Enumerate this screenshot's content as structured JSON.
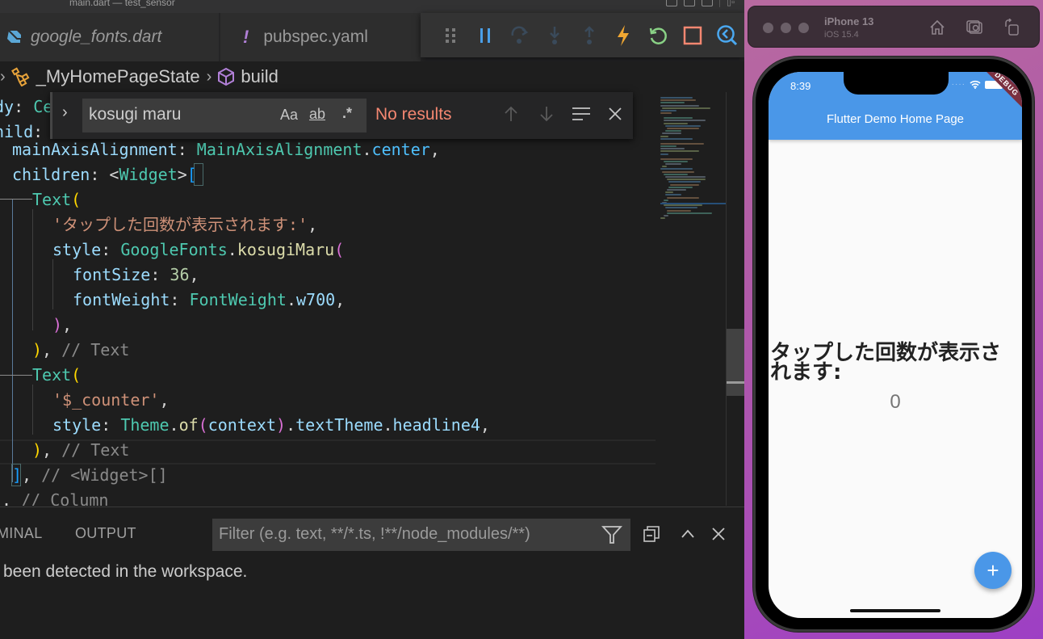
{
  "window": {
    "title": "main.dart — test_sensor"
  },
  "tabs": [
    {
      "label": "google_fonts.dart",
      "icon": "dart-file-icon",
      "italic": true
    },
    {
      "label": "pubspec.yaml",
      "icon": "yaml-warning-icon"
    }
  ],
  "debug_toolbar": {
    "buttons": [
      {
        "name": "drag-handle",
        "icon": "grip-icon"
      },
      {
        "name": "pause",
        "icon": "pause-icon",
        "color": "#4a9fe8"
      },
      {
        "name": "step-over",
        "icon": "step-over-icon",
        "disabled": true
      },
      {
        "name": "step-into",
        "icon": "step-into-icon",
        "disabled": true
      },
      {
        "name": "step-out",
        "icon": "step-out-icon",
        "disabled": true
      },
      {
        "name": "hot-reload",
        "icon": "lightning-icon",
        "color": "#f0a732"
      },
      {
        "name": "hot-restart",
        "icon": "restart-icon",
        "color": "#89d185"
      },
      {
        "name": "stop",
        "icon": "stop-icon",
        "color": "#f48771"
      },
      {
        "name": "flutter-inspector",
        "icon": "inspector-icon",
        "color": "#4aa8f0"
      }
    ]
  },
  "breadcrumb": {
    "items": [
      {
        "label": "_MyHomePageState",
        "icon": "class-icon"
      },
      {
        "label": "build",
        "icon": "method-icon"
      }
    ]
  },
  "find": {
    "query": "kosugi maru",
    "match_case_label": "Aa",
    "whole_word_label": "ab",
    "regex_label": ".*",
    "status": "No results"
  },
  "code": {
    "lines": [
      "dy: Ce",
      "hild:",
      "  mainAxisAlignment: MainAxisAlignment.center,",
      "  children: <Widget>[",
      "    Text(",
      "      'タップした回数が表示されます:',",
      "      style: GoogleFonts.kosugiMaru(",
      "        fontSize: 36,",
      "        fontWeight: FontWeight.w700,",
      "      ),",
      "    ), // Text",
      "    Text(",
      "      '$_counter',",
      "      style: Theme.of(context).textTheme.headline4,",
      "    ), // Text",
      "  ], // <Widget>[]",
      ", // Column"
    ],
    "tokens": {
      "l0a": "dy",
      "l0b": ": ",
      "l0c": "Ce",
      "l1a": "hild",
      "l1b": ":",
      "l2a": "mainAxisAlignment",
      "l2b": ": ",
      "l2c": "MainAxisAlignment",
      "l2d": ".",
      "l2e": "center",
      "l2f": ",",
      "l3a": "children",
      "l3b": ": <",
      "l3c": "Widget",
      "l3d": ">",
      "l3e": "[",
      "l4a": "Text",
      "l4b": "(",
      "l5a": "'タップした回数が表示されます:'",
      "l5b": ",",
      "l6a": "style",
      "l6b": ": ",
      "l6c": "GoogleFonts",
      "l6d": ".",
      "l6e": "kosugiMaru",
      "l6f": "(",
      "l7a": "fontSize",
      "l7b": ": ",
      "l7c": "36",
      "l7d": ",",
      "l8a": "fontWeight",
      "l8b": ": ",
      "l8c": "FontWeight",
      "l8d": ".",
      "l8e": "w700",
      "l8f": ",",
      "l9a": ")",
      "l9b": ",",
      "l10a": ")",
      "l10b": ", ",
      "l10c": "// Text",
      "l11a": "Text",
      "l11b": "(",
      "l12a": "'$_counter'",
      "l12b": ",",
      "l13a": "style",
      "l13b": ": ",
      "l13c": "Theme",
      "l13d": ".",
      "l13e": "of",
      "l13f": "(",
      "l13g": "context",
      "l13h": ")",
      "l13i": ".",
      "l13j": "textTheme",
      "l13k": ".",
      "l13l": "headline4",
      "l13m": ",",
      "l14a": ")",
      "l14b": ", ",
      "l14c": "// Text",
      "l15a": "]",
      "l15b": ", ",
      "l15c": "// <Widget>[]",
      "l16a": ". ",
      "l16b": "// Column"
    }
  },
  "panel": {
    "tabs": [
      {
        "label": "MINAL"
      },
      {
        "label": "OUTPUT"
      }
    ],
    "filter_placeholder": "Filter (e.g. text, **/*.ts, !**/node_modules/**)",
    "message": "been detected in the workspace."
  },
  "simulator": {
    "device": "iPhone 13",
    "os": "iOS 15.4",
    "buttons": [
      {
        "name": "home",
        "icon": "home-icon"
      },
      {
        "name": "screenshot",
        "icon": "camera-icon"
      },
      {
        "name": "rotate",
        "icon": "rotate-icon"
      }
    ]
  },
  "app": {
    "status_time": "8:39",
    "title": "Flutter Demo Home Page",
    "debug_banner": "DEBUG",
    "counter_label": "タップした回数が表示されます:",
    "counter_value": "0",
    "fab_label": "+",
    "primary_color": "#4a97e8"
  }
}
